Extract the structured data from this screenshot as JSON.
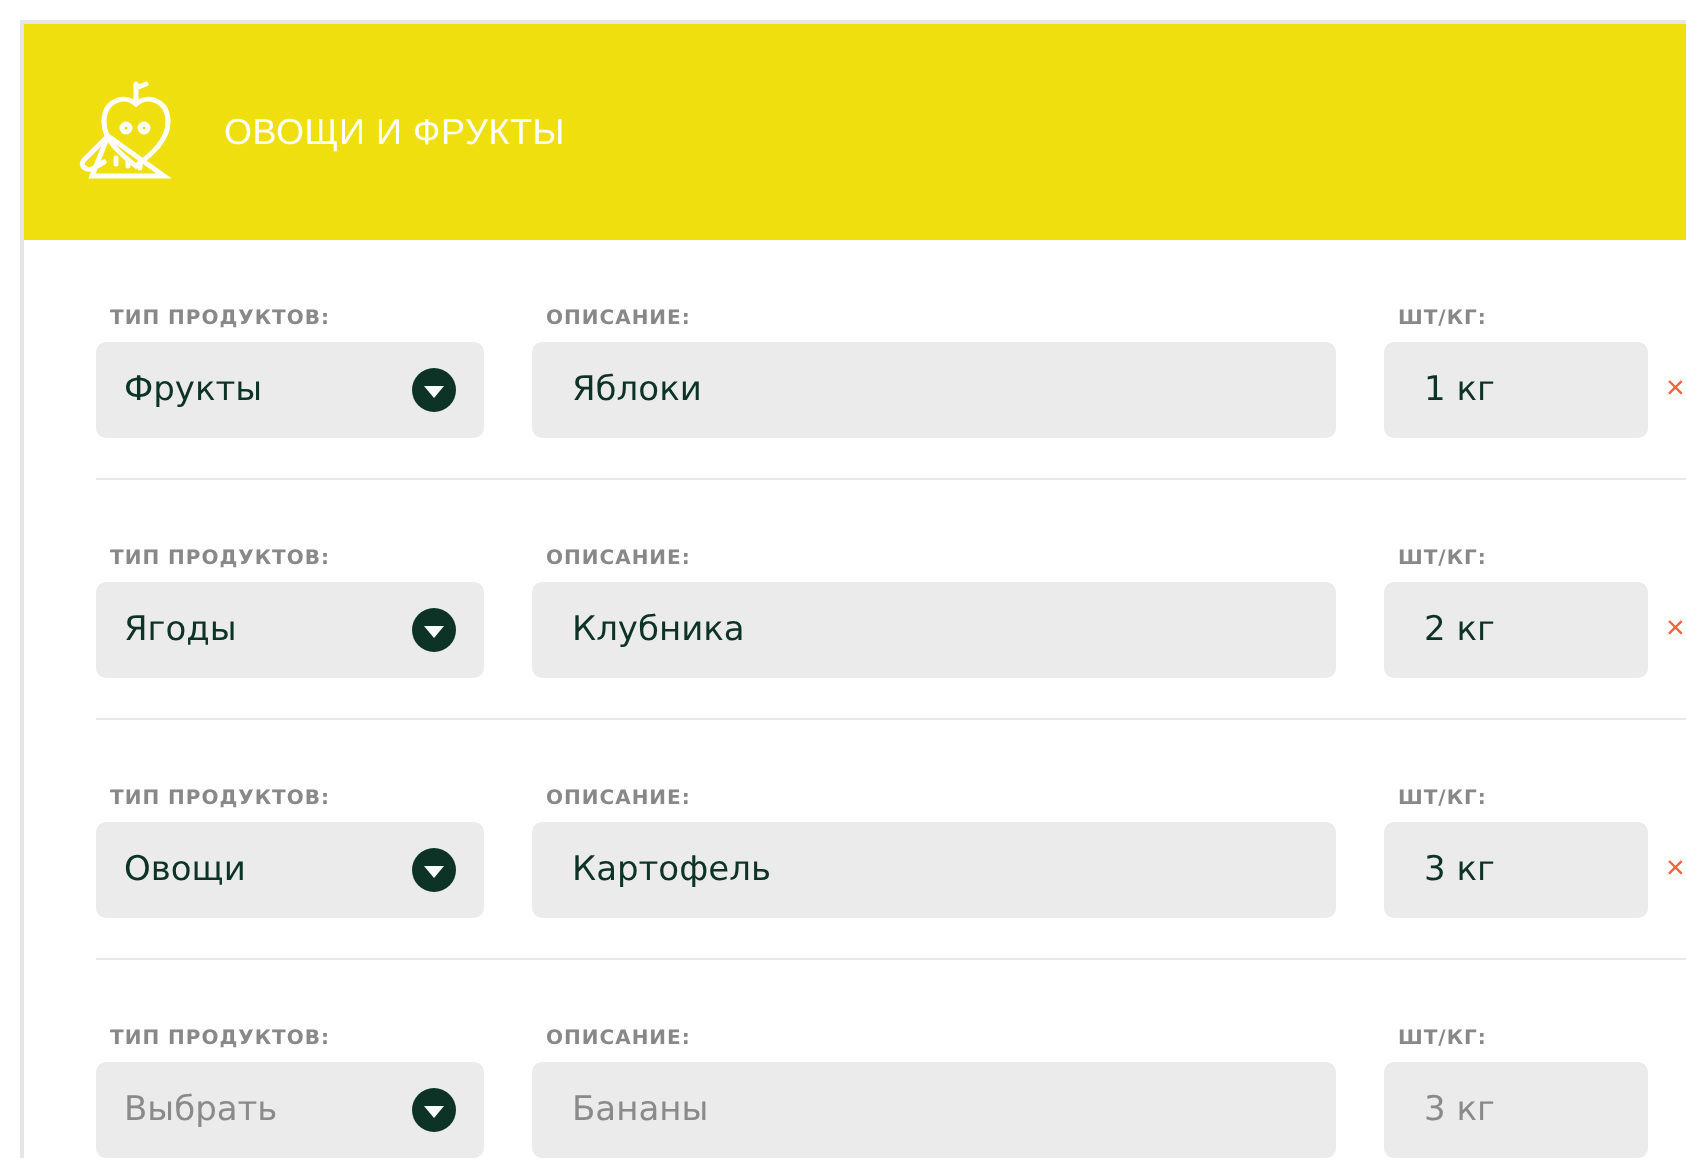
{
  "header": {
    "title": "ОВОЩИ И ФРУКТЫ"
  },
  "rows": [
    {
      "type_label": "ТИП ПРОДУКТОВ:",
      "type": {
        "value": "Фрукты"
      },
      "description_label": "ОПИСАНИЕ:",
      "description": {
        "value": "Яблоки"
      },
      "quantity_label": "ШТ/КГ:",
      "quantity": {
        "value": "1 кг"
      },
      "remove": "×"
    },
    {
      "type_label": "ТИП ПРОДУКТОВ:",
      "type": {
        "value": "Ягоды"
      },
      "description_label": "ОПИСАНИЕ:",
      "description": {
        "value": "Клубника"
      },
      "quantity_label": "ШТ/КГ:",
      "quantity": {
        "value": "2 кг"
      },
      "remove": "×"
    },
    {
      "type_label": "ТИП ПРОДУКТОВ:",
      "type": {
        "value": "Овощи"
      },
      "description_label": "ОПИСАНИЕ:",
      "description": {
        "value": "Картофель"
      },
      "quantity_label": "ШТ/КГ:",
      "quantity": {
        "value": "3 кг"
      },
      "remove": "×"
    },
    {
      "type_label": "ТИП ПРОДУКТОВ:",
      "type": {
        "placeholder": "Выбрать"
      },
      "description_label": "ОПИСАНИЕ:",
      "description": {
        "placeholder": "Бананы"
      },
      "quantity_label": "ШТ/КГ:",
      "quantity": {
        "placeholder": "3 кг"
      }
    }
  ]
}
